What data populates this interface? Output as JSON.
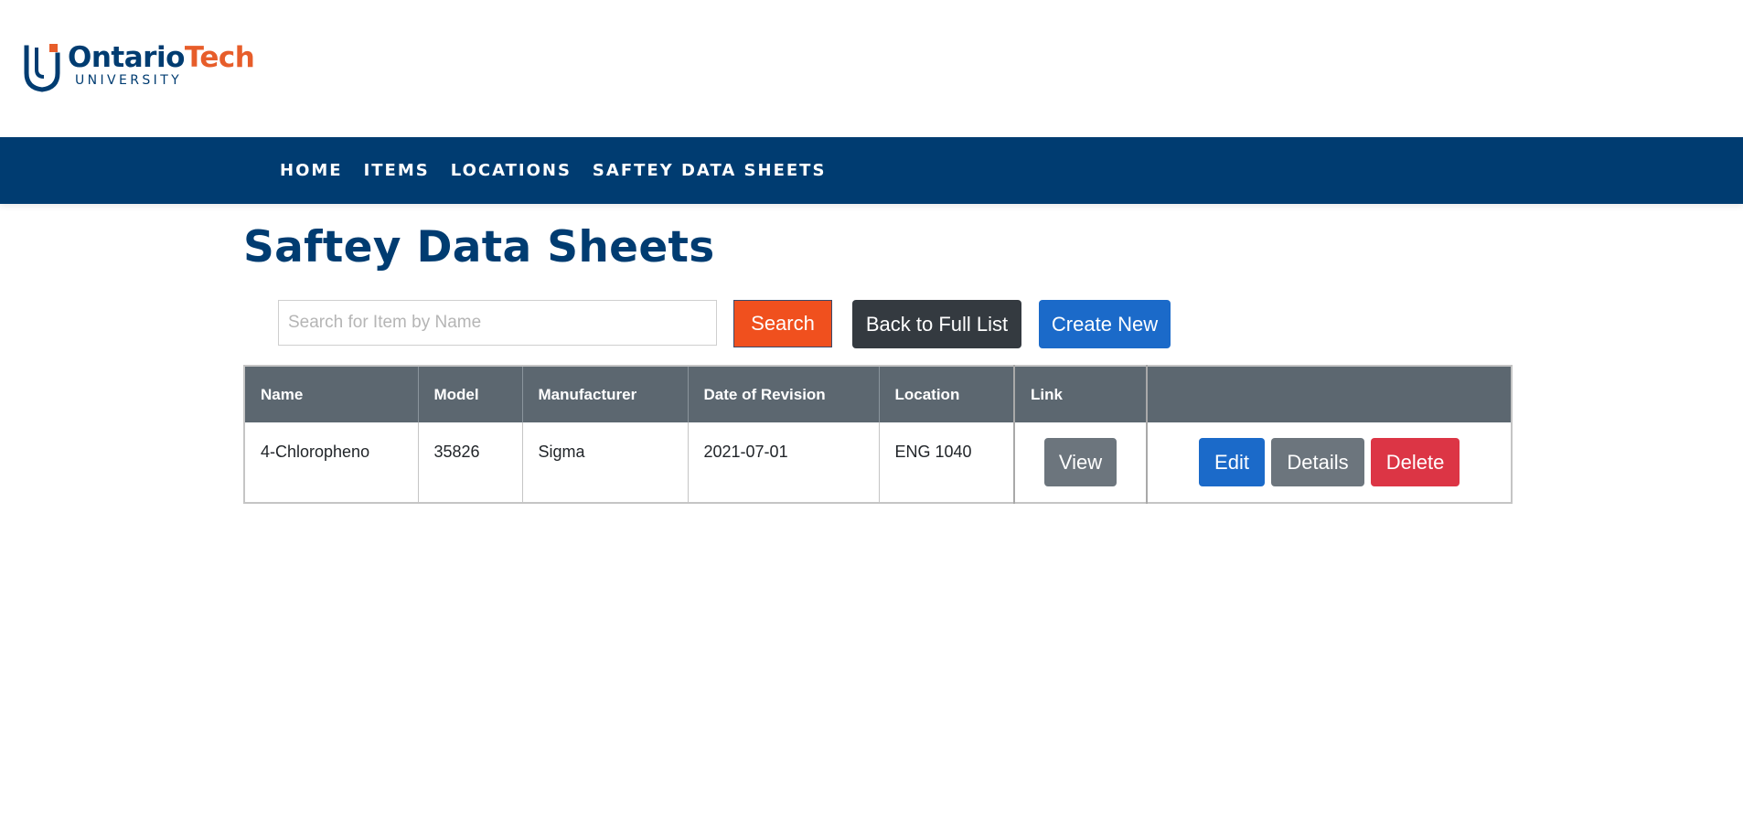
{
  "logo": {
    "name_part1": "Ontario",
    "name_part2": "Tech",
    "sub": "UNIVERSITY",
    "icon": "ontario-tech-shield-icon"
  },
  "nav": {
    "items": [
      {
        "label": "HOME"
      },
      {
        "label": "ITEMS"
      },
      {
        "label": "LOCATIONS"
      },
      {
        "label": "SAFTEY DATA SHEETS"
      }
    ]
  },
  "page": {
    "title": "Saftey Data Sheets"
  },
  "search": {
    "placeholder": "Search for Item by Name",
    "value": "",
    "button_label": "Search"
  },
  "toolbar": {
    "back_label": "Back to Full List",
    "create_label": "Create New"
  },
  "table": {
    "headers": [
      "Name",
      "Model",
      "Manufacturer",
      "Date of Revision",
      "Location",
      "Link",
      ""
    ],
    "rows": [
      {
        "name": "4-Chloropheno",
        "model": "35826",
        "manufacturer": "Sigma",
        "date": "2021-07-01",
        "location": "ENG 1040",
        "link_label": "View",
        "edit_label": "Edit",
        "details_label": "Details",
        "delete_label": "Delete"
      }
    ]
  },
  "colors": {
    "navy": "#003c71",
    "orange": "#e75d2a",
    "search_button": "#f0501e",
    "dark_button": "#343a40",
    "primary_button": "#1b6ac9",
    "secondary_button": "#6c757d",
    "danger_button": "#dc3545",
    "table_header": "#5c6770"
  }
}
